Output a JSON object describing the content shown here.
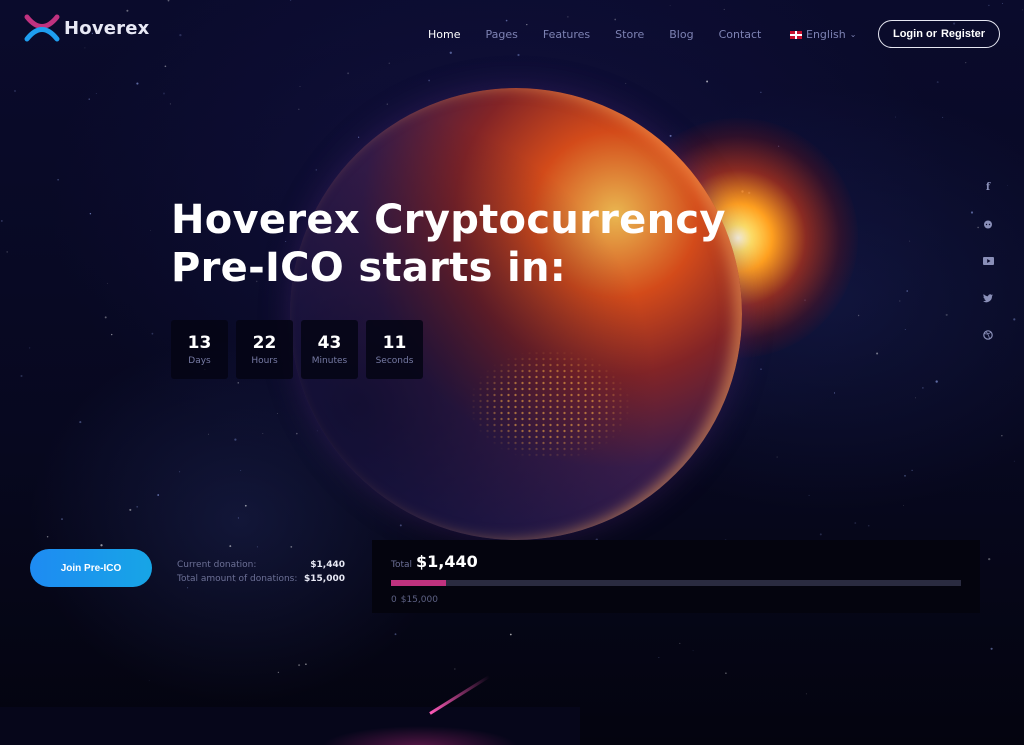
{
  "header": {
    "logo_text": "Hoverex",
    "nav": [
      {
        "label": "Home",
        "active": true
      },
      {
        "label": "Pages",
        "active": false
      },
      {
        "label": "Features",
        "active": false
      },
      {
        "label": "Store",
        "active": false
      },
      {
        "label": "Blog",
        "active": false
      },
      {
        "label": "Contact",
        "active": false
      }
    ],
    "language": {
      "label": "English",
      "flag": "uk-flag-icon",
      "chevron": "chevron-down-icon"
    },
    "login": {
      "login_label": "Login or",
      "register_label": "Register"
    }
  },
  "hero": {
    "title_line1": "Hoverex Cryptocurrency",
    "title_line2": "Pre-ICO starts in:",
    "countdown": [
      {
        "value": "13",
        "label": "Days"
      },
      {
        "value": "22",
        "label": "Hours"
      },
      {
        "value": "43",
        "label": "Minutes"
      },
      {
        "value": "11",
        "label": "Seconds"
      }
    ]
  },
  "social": [
    "facebook-icon",
    "reddit-icon",
    "youtube-icon",
    "twitter-icon",
    "dribbble-icon"
  ],
  "donation": {
    "join_label": "Join Pre-ICO",
    "current_label": "Current donation:",
    "current_value": "$1,440",
    "total_label": "Total amount of donations:",
    "total_value": "$15,000",
    "panel_total_label": "Total",
    "panel_total_value": "$1,440",
    "progress_percent": 9.6,
    "scale_min": "0",
    "scale_max": "$15,000"
  },
  "colors": {
    "accent_blue": "#1e8bf2",
    "progress_pink": "#c0327f",
    "nav_inactive": "#7d82b3"
  }
}
